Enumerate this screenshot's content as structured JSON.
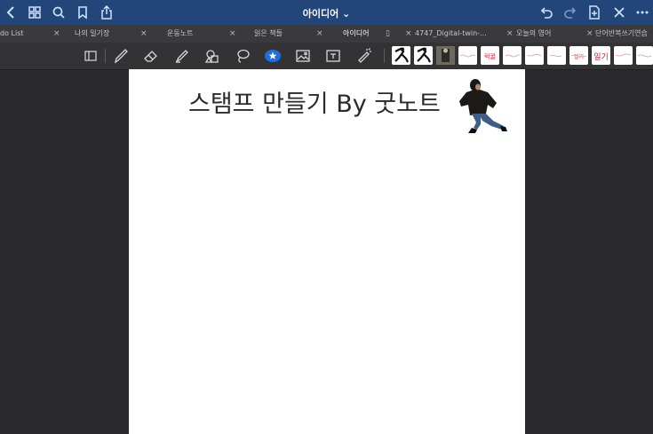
{
  "header": {
    "title": "아이디어 ⌄",
    "icons": [
      "back-icon",
      "grid-icon",
      "search-icon",
      "bookmark-icon",
      "share-icon",
      "undo-icon",
      "redo-icon",
      "add-page-icon",
      "close-icon",
      "more-icon"
    ]
  },
  "tabs": [
    {
      "label": "do List"
    },
    {
      "label": "나의 일기장"
    },
    {
      "label": "운동노트"
    },
    {
      "label": "읽은 책들"
    },
    {
      "label": "아이디어",
      "active": true
    },
    {
      "label": "4747_Digital-twin-..."
    },
    {
      "label": "오늘의 영어"
    },
    {
      "label": "단어반복쓰기연습"
    }
  ],
  "toolbar": {
    "tools": [
      "read-mode-icon",
      "pen-icon",
      "eraser-icon",
      "highlighter-icon",
      "shape-icon",
      "lasso-icon",
      "sticker-icon",
      "image-icon",
      "text-icon",
      "laser-icon"
    ],
    "stamps": [
      "",
      "",
      "",
      "",
      "럭꿀",
      "",
      "",
      "",
      "일기",
      "",
      ""
    ]
  },
  "page": {
    "heading": "스탬프 만들기 By 굿노트"
  }
}
